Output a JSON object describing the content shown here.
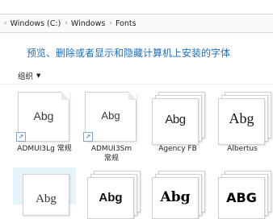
{
  "breadcrumb": [
    "Windows (C:)",
    "Windows",
    "Fonts"
  ],
  "description": "预览、删除或者显示和隐藏计算机上安装的字体",
  "toolbar": {
    "organize_label": "组织"
  },
  "fonts": [
    {
      "sample": "Abg",
      "label": "ADMUI3Lg 常规",
      "shortcut": true
    },
    {
      "sample": "Abg",
      "label": "ADMUI3Sm 常规",
      "shortcut": true
    },
    {
      "sample": "Abg",
      "label": "Agency FB",
      "shortcut": false
    },
    {
      "sample": "Abg",
      "label": "Albertus",
      "shortcut": false
    },
    {
      "sample": "Abg",
      "label": "",
      "shortcut": false
    },
    {
      "sample": "Abg",
      "label": "",
      "shortcut": false
    },
    {
      "sample": "Abg",
      "label": "",
      "shortcut": false
    },
    {
      "sample": "ABG",
      "label": "",
      "shortcut": false
    }
  ],
  "colors": {
    "accent": "#1e6fb8",
    "selection": "#e5f3fb"
  },
  "icons": {
    "shortcut_overlay": "shortcut-arrow-icon"
  }
}
